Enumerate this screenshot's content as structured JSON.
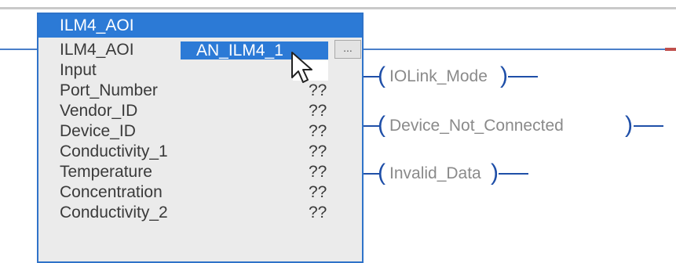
{
  "aoi": {
    "title": "ILM4_AOI",
    "tag_row_label": "ILM4_AOI",
    "tag_value": "AN_ILM4_1",
    "ellipsis_label": "...",
    "params": [
      {
        "name": "Input",
        "value": ""
      },
      {
        "name": "Port_Number",
        "value": "??"
      },
      {
        "name": "Vendor_ID",
        "value": "??"
      },
      {
        "name": "Device_ID",
        "value": "??"
      },
      {
        "name": "Conductivity_1",
        "value": "??"
      },
      {
        "name": "Temperature",
        "value": "??"
      },
      {
        "name": "Concentration",
        "value": "??"
      },
      {
        "name": "Conductivity_2",
        "value": "??"
      }
    ]
  },
  "outputs": {
    "iolink_mode": "IOLink_Mode",
    "device_not_connected": "Device_Not_Connected",
    "invalid_data": "Invalid_Data"
  },
  "colors": {
    "accent": "#2c7ad6",
    "rung": "#4a7fc9",
    "coil": "#1f4fa8",
    "label_gray": "#8a8a8a"
  }
}
